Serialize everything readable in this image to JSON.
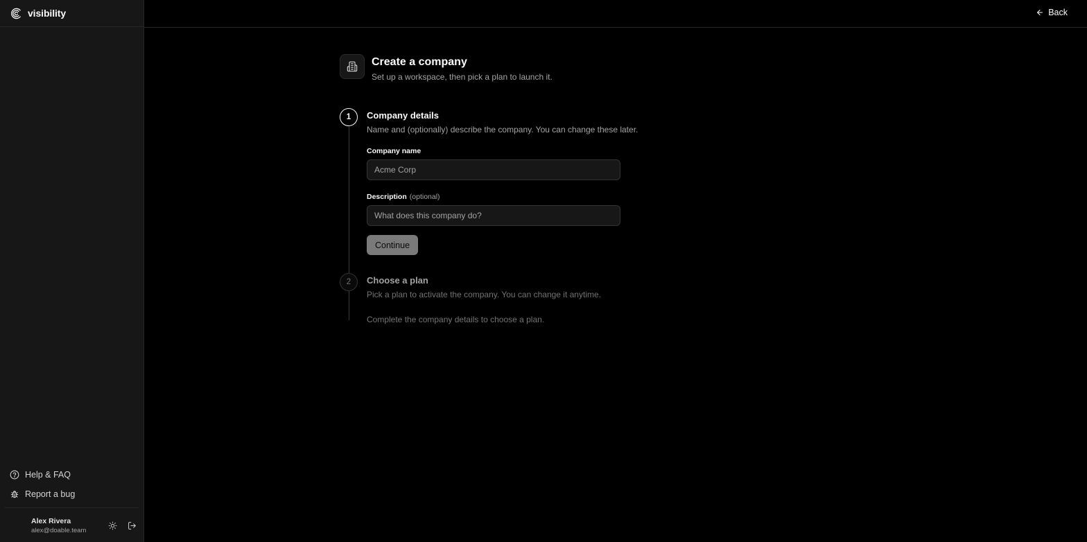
{
  "brand": {
    "name": "visibility"
  },
  "topbar": {
    "back_label": "Back"
  },
  "header": {
    "title": "Create a company",
    "subtitle": "Set up a workspace, then pick a plan to launch it."
  },
  "steps": [
    {
      "number": "1",
      "title": "Company details",
      "description": "Name and (optionally) describe the company. You can change these later.",
      "fields": {
        "name_label": "Company name",
        "name_placeholder": "Acme Corp",
        "description_label": "Description",
        "description_optional": "(optional)",
        "description_placeholder": "What does this company do?"
      },
      "button_label": "Continue"
    },
    {
      "number": "2",
      "title": "Choose a plan",
      "description": "Pick a plan to activate the company. You can change it anytime.",
      "note": "Complete the company details to choose a plan."
    }
  ],
  "sidebar": {
    "links": [
      {
        "label": "Help & FAQ",
        "icon": "help-circle-icon"
      },
      {
        "label": "Report a bug",
        "icon": "bug-icon"
      }
    ],
    "user": {
      "name": "Alex Rivera",
      "email": "alex@doable.team"
    }
  },
  "colors": {
    "background": "#000000",
    "sidebar": "#171717",
    "border": "#262626",
    "button_disabled": "#7a7a7a"
  }
}
